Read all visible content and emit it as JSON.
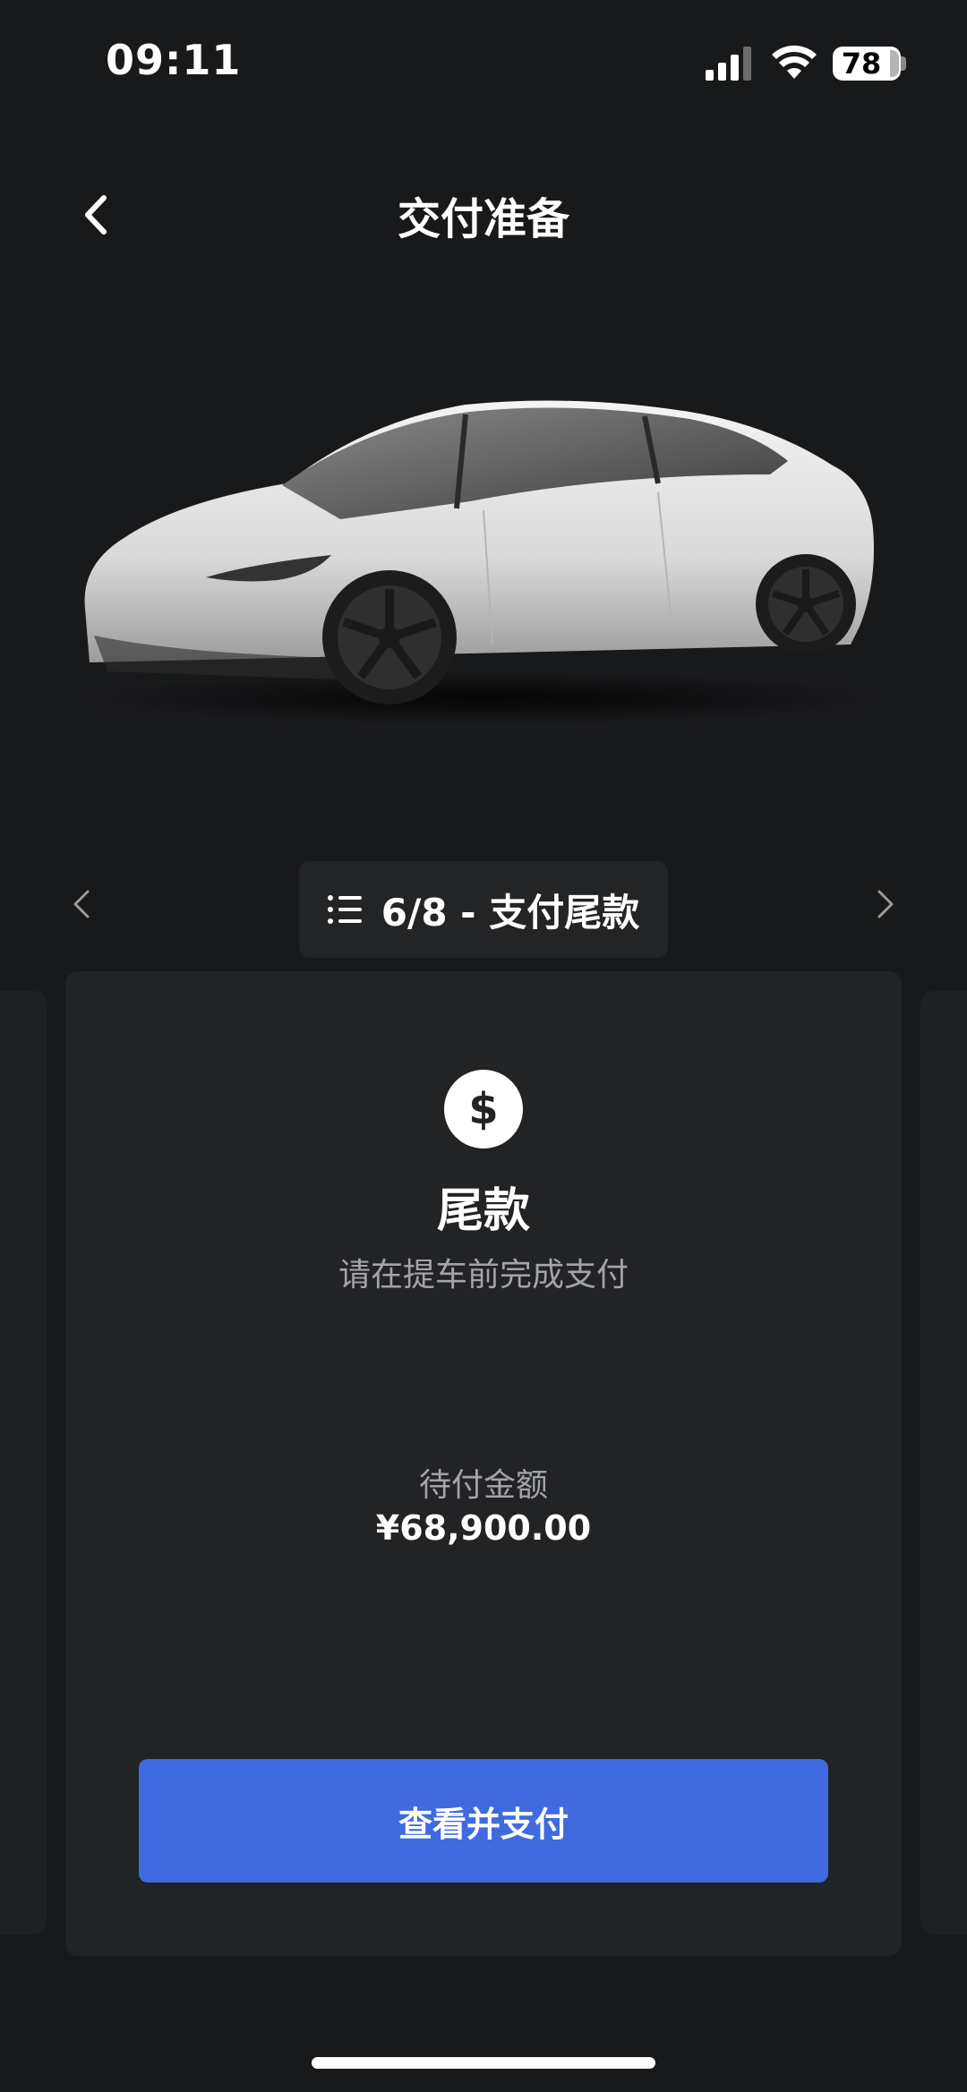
{
  "status_bar": {
    "time": "09:11",
    "battery": "78"
  },
  "header": {
    "title": "交付准备"
  },
  "stepper": {
    "label": "6/8 - 支付尾款"
  },
  "card": {
    "title": "尾款",
    "subtitle": "请在提车前完成支付",
    "amount_label": "待付金额",
    "amount_value": "¥68,900.00",
    "pay_button": "查看并支付",
    "icon": "$"
  },
  "colors": {
    "background": "#18191b",
    "card": "#222325",
    "accent": "#3f6ae0"
  }
}
